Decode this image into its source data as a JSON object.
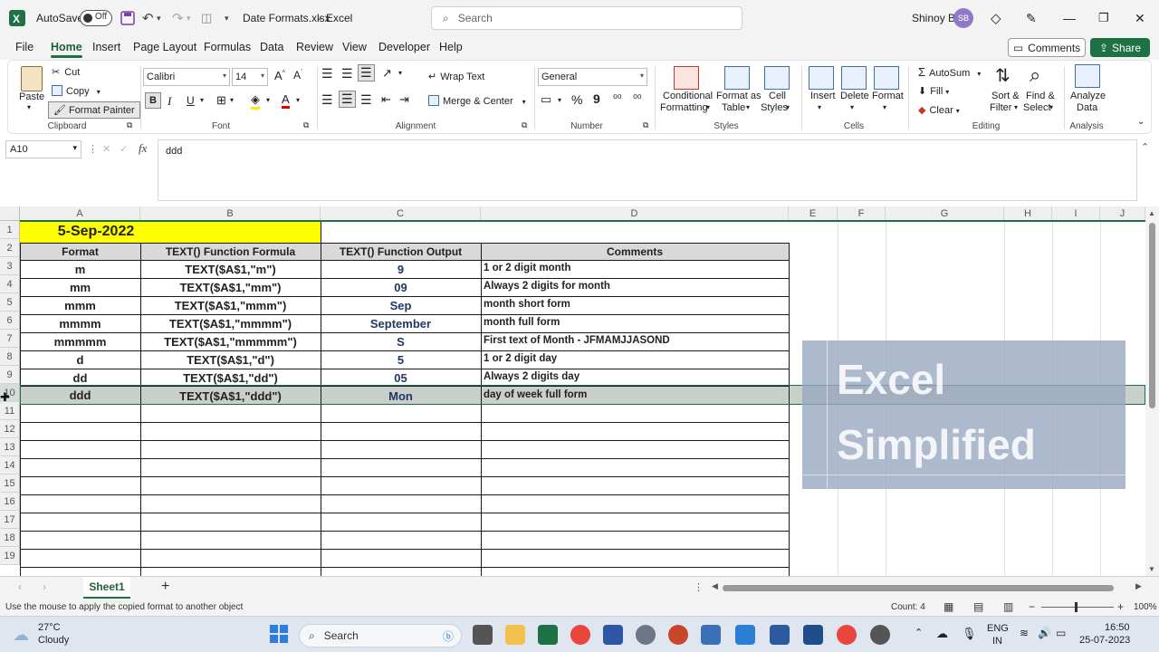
{
  "titlebar": {
    "autosave_label": "AutoSave",
    "autosave_state": "Off",
    "filename": "Date Formats.xlsx",
    "separator": "-",
    "app_name": "Excel",
    "search_placeholder": "Search",
    "user_name": "Shinoy B",
    "user_initials": "SB"
  },
  "menu": {
    "tabs": [
      "File",
      "Home",
      "Insert",
      "Page Layout",
      "Formulas",
      "Data",
      "Review",
      "View",
      "Developer",
      "Help"
    ],
    "active": "Home",
    "comments_label": "Comments",
    "share_label": "Share"
  },
  "ribbon": {
    "clipboard": {
      "paste": "Paste",
      "cut": "Cut",
      "copy": "Copy",
      "format_painter": "Format Painter",
      "label": "Clipboard"
    },
    "font": {
      "name": "Calibri",
      "size": "14",
      "label": "Font"
    },
    "alignment": {
      "wrap_text": "Wrap Text",
      "merge_center": "Merge & Center",
      "label": "Alignment"
    },
    "number": {
      "format": "General",
      "label": "Number"
    },
    "styles": {
      "conditional_1": "Conditional",
      "conditional_2": "Formatting",
      "format_table_1": "Format as",
      "format_table_2": "Table",
      "cell_styles_1": "Cell",
      "cell_styles_2": "Styles",
      "label": "Styles"
    },
    "cells": {
      "insert": "Insert",
      "delete": "Delete",
      "format": "Format",
      "label": "Cells"
    },
    "editing": {
      "autosum": "AutoSum",
      "fill": "Fill",
      "clear": "Clear",
      "sort_1": "Sort &",
      "sort_2": "Filter",
      "find_1": "Find &",
      "find_2": "Select",
      "label": "Editing"
    },
    "analysis": {
      "analyze_1": "Analyze",
      "analyze_2": "Data",
      "label": "Analysis"
    }
  },
  "formula_bar": {
    "cell_ref": "A10",
    "fx": "fx",
    "content": "ddd"
  },
  "grid": {
    "columns": [
      "A",
      "B",
      "C",
      "D",
      "E",
      "F",
      "G",
      "H",
      "I",
      "J"
    ],
    "rows": [
      "1",
      "2",
      "3",
      "4",
      "5",
      "6",
      "7",
      "8",
      "9",
      "10",
      "11",
      "12",
      "13",
      "14",
      "15",
      "16",
      "17",
      "18",
      "19"
    ],
    "a1": "5-Sep-2022",
    "headers": [
      "Format",
      "TEXT() Function Formula",
      "TEXT() Function Output",
      "Comments"
    ],
    "data": [
      [
        "m",
        "TEXT($A$1,\"m\")",
        "9",
        "1 or 2 digit month"
      ],
      [
        "mm",
        "TEXT($A$1,\"mm\")",
        "09",
        "Always 2 digits for month"
      ],
      [
        "mmm",
        "TEXT($A$1,\"mmm\")",
        "Sep",
        "month short form"
      ],
      [
        "mmmm",
        "TEXT($A$1,\"mmmm\")",
        "September",
        "month full form"
      ],
      [
        "mmmmm",
        "TEXT($A$1,\"mmmmm\")",
        "S",
        "First text of Month - JFMAMJJASOND"
      ],
      [
        "d",
        "TEXT($A$1,\"d\")",
        "5",
        "1 or 2 digit day"
      ],
      [
        "dd",
        "TEXT($A$1,\"dd\")",
        "05",
        "Always 2 digits day"
      ],
      [
        "ddd",
        "TEXT($A$1,\"ddd\")",
        "Mon",
        "day of week full form"
      ]
    ],
    "colors": {
      "a1_fill": "#ffff00",
      "header_fill": "#d9d9d9",
      "selected_row_fill": "#c9cfcb",
      "output_color": "#1f3864"
    }
  },
  "watermark": {
    "line1": "Excel",
    "line2": "Simplified"
  },
  "sheets": {
    "tabs": [
      "Sheet1"
    ],
    "active": "Sheet1"
  },
  "status": {
    "message": "Use the mouse to apply the copied format to another object",
    "count": "Count: 4",
    "zoom": "100%"
  },
  "taskbar": {
    "weather_temp": "27°C",
    "weather_desc": "Cloudy",
    "search_label": "Search",
    "lang1": "ENG",
    "lang2": "IN",
    "time": "16:50",
    "date": "25-07-2023"
  }
}
